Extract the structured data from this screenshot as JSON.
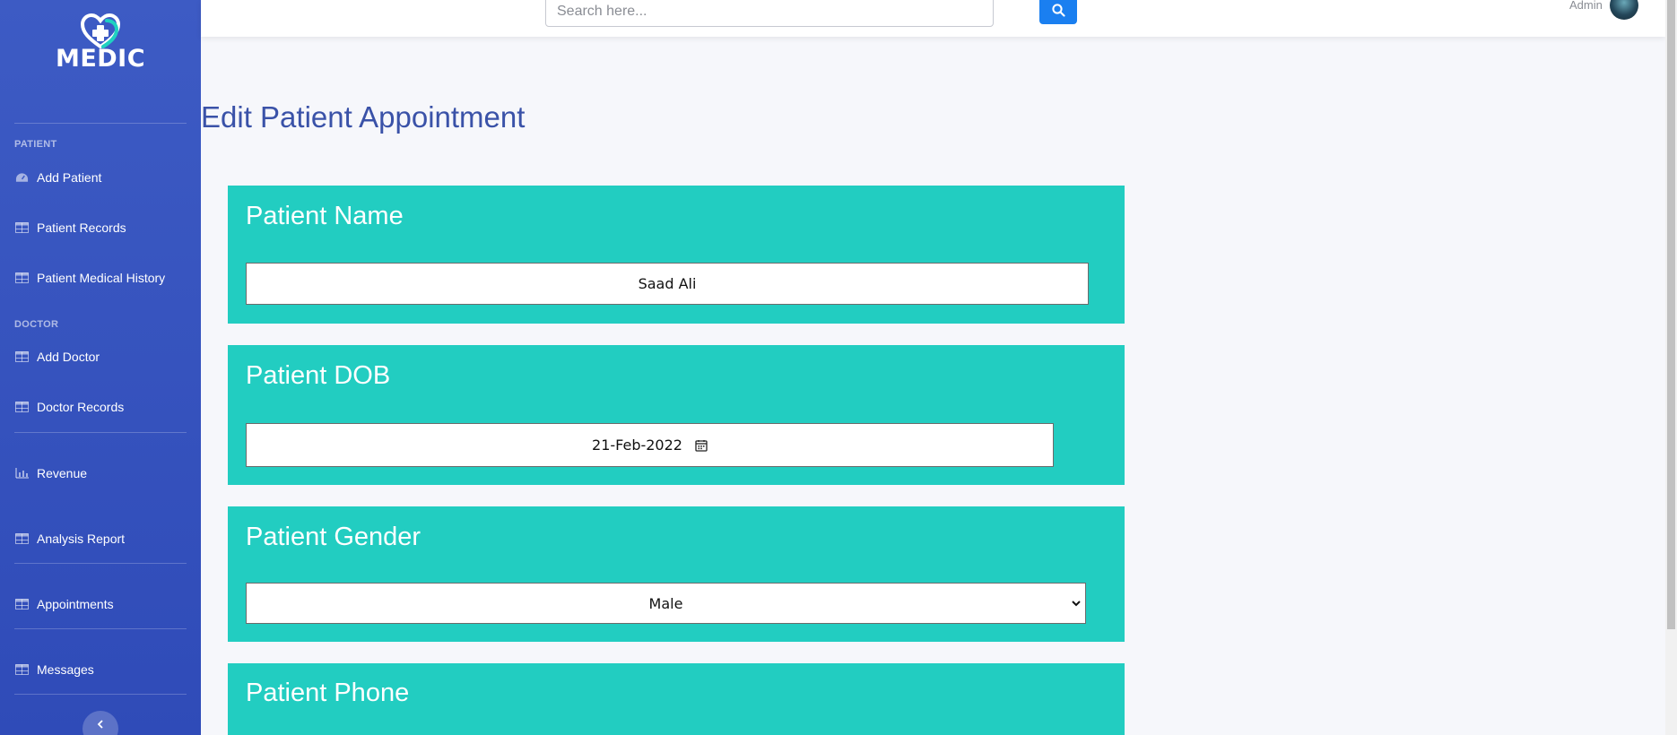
{
  "brand": {
    "name": "MEDIC"
  },
  "sidebar": {
    "sections": {
      "patient": "PATIENT",
      "doctor": "DOCTOR"
    },
    "items": [
      {
        "label": "Add Patient",
        "icon": "dashboard-icon"
      },
      {
        "label": "Patient Records",
        "icon": "table-icon"
      },
      {
        "label": "Patient Medical History",
        "icon": "table-icon"
      },
      {
        "label": "Add Doctor",
        "icon": "table-icon"
      },
      {
        "label": "Doctor Records",
        "icon": "table-icon"
      },
      {
        "label": "Revenue",
        "icon": "chart-bar-icon"
      },
      {
        "label": "Analysis Report",
        "icon": "table-icon"
      },
      {
        "label": "Appointments",
        "icon": "table-icon"
      },
      {
        "label": "Messages",
        "icon": "table-icon"
      }
    ],
    "collapse_icon": "chevron-left-icon"
  },
  "topbar": {
    "search": {
      "placeholder": "Search here...",
      "value": ""
    },
    "user_name": "Admin"
  },
  "page": {
    "title": "Edit Patient Appointment"
  },
  "form": {
    "name": {
      "label": "Patient Name",
      "value": "Saad Ali"
    },
    "dob": {
      "label": "Patient DOB",
      "value": "21-Feb-2022"
    },
    "gender": {
      "label": "Patient Gender",
      "value": "Male"
    },
    "phone": {
      "label": "Patient Phone"
    }
  },
  "colors": {
    "sidebar": "#3d5bc4",
    "card": "#22cdc1",
    "title": "#3a52a8",
    "search_button": "#1a7ff0"
  }
}
